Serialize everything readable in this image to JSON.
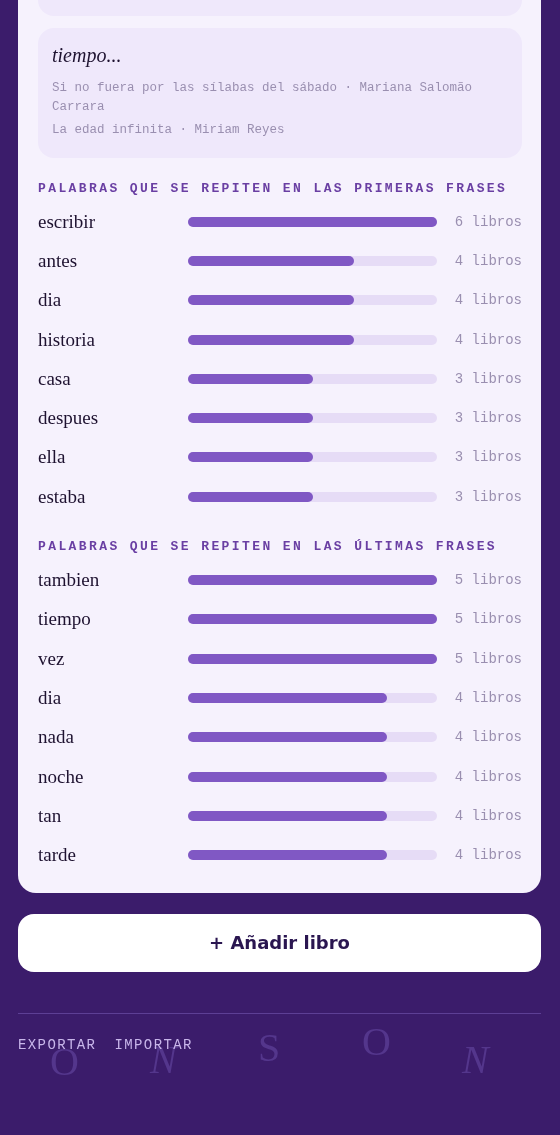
{
  "background_letters": [
    {
      "char": "O",
      "italic": false
    },
    {
      "char": "N",
      "italic": true
    },
    {
      "char": "S",
      "italic": false
    },
    {
      "char": "O",
      "italic": false
    },
    {
      "char": "N",
      "italic": true
    }
  ],
  "quote_card": {
    "title": "tiempo...",
    "sources": [
      "Si no fuera por las sílabas del sábado · Mariana Salomão Carrara",
      "La edad infinita · Miriam Reyes"
    ]
  },
  "sections": [
    {
      "title": "PALABRAS QUE SE REPITEN EN LAS PRIMERAS FRASES",
      "words": [
        {
          "word": "escribir",
          "level": 1,
          "count": "6 libros"
        },
        {
          "word": "antes",
          "level": 0.667,
          "count": "4 libros"
        },
        {
          "word": "dia",
          "level": 0.667,
          "count": "4 libros"
        },
        {
          "word": "historia",
          "level": 0.667,
          "count": "4 libros"
        },
        {
          "word": "casa",
          "level": 0.5,
          "count": "3 libros"
        },
        {
          "word": "despues",
          "level": 0.5,
          "count": "3 libros"
        },
        {
          "word": "ella",
          "level": 0.5,
          "count": "3 libros"
        },
        {
          "word": "estaba",
          "level": 0.5,
          "count": "3 libros"
        }
      ]
    },
    {
      "title": "PALABRAS QUE SE REPITEN EN LAS ÚLTIMAS FRASES",
      "words": [
        {
          "word": "tambien",
          "level": 1,
          "count": "5 libros"
        },
        {
          "word": "tiempo",
          "level": 1,
          "count": "5 libros"
        },
        {
          "word": "vez",
          "level": 1,
          "count": "5 libros"
        },
        {
          "word": "dia",
          "level": 0.8,
          "count": "4 libros"
        },
        {
          "word": "nada",
          "level": 0.8,
          "count": "4 libros"
        },
        {
          "word": "noche",
          "level": 0.8,
          "count": "4 libros"
        },
        {
          "word": "tan",
          "level": 0.8,
          "count": "4 libros"
        },
        {
          "word": "tarde",
          "level": 0.8,
          "count": "4 libros"
        }
      ]
    }
  ],
  "add_button": "+ Añadir libro",
  "footer_links": [
    "EXPORTAR",
    "IMPORTAR"
  ]
}
